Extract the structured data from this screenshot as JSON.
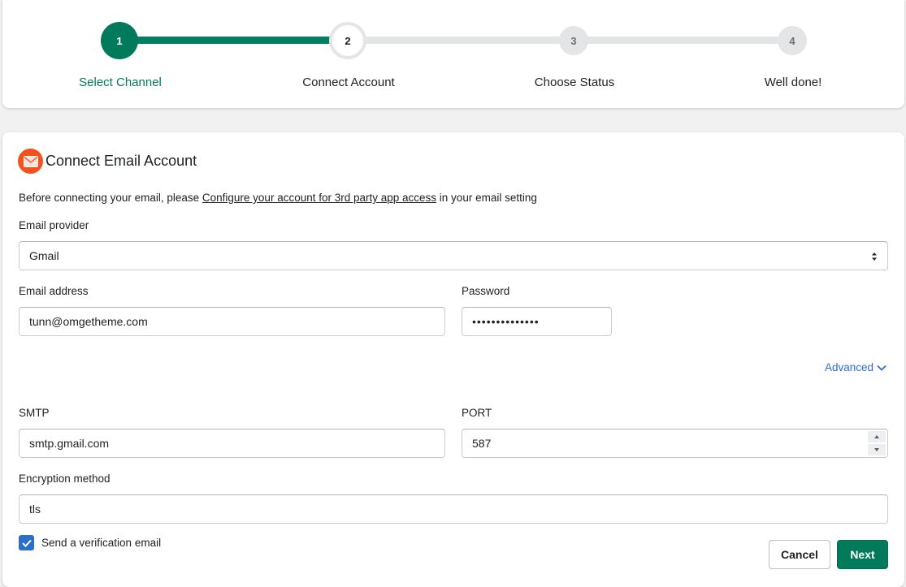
{
  "stepper": {
    "steps": [
      {
        "number": "1",
        "label": "Select Channel",
        "state": "completed"
      },
      {
        "number": "2",
        "label": "Connect Account",
        "state": "current"
      },
      {
        "number": "3",
        "label": "Choose Status",
        "state": "pending"
      },
      {
        "number": "4",
        "label": "Well done!",
        "state": "pending"
      }
    ]
  },
  "form": {
    "title": "Connect Email Account",
    "title_icon": "mail-icon",
    "intro_before": "Before connecting your email, please ",
    "intro_link": "Configure your account for 3rd party app access",
    "intro_after": " in your email setting",
    "provider": {
      "label": "Email provider",
      "value": "Gmail"
    },
    "email": {
      "label": "Email address",
      "value": "tunn@omgetheme.com"
    },
    "password": {
      "label": "Password",
      "value": "••••••••••••••"
    },
    "advanced_label": "Advanced",
    "smtp": {
      "label": "SMTP",
      "value": "smtp.gmail.com"
    },
    "port": {
      "label": "PORT",
      "value": "587"
    },
    "encryption": {
      "label": "Encryption method",
      "value": "tls"
    },
    "verify": {
      "label": "Send a verification email",
      "checked": true
    },
    "cancel_label": "Cancel",
    "next_label": "Next"
  },
  "colors": {
    "primary": "#007a5a",
    "link": "#2c6ecb",
    "mail_badge": "#f4511e",
    "track_inactive": "#e4e5e7"
  }
}
